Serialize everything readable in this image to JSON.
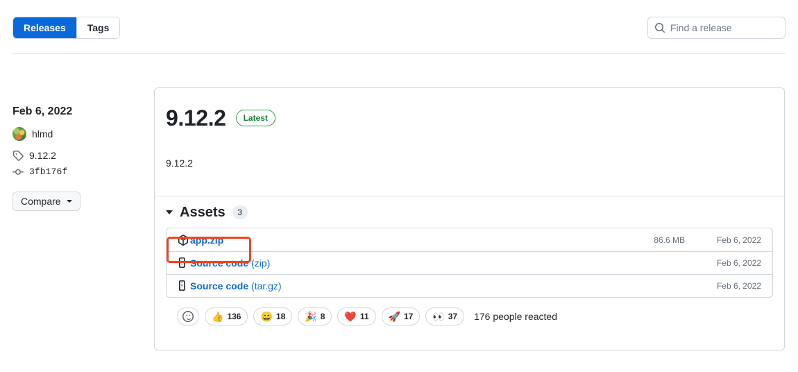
{
  "tabs": {
    "releases_label": "Releases",
    "tags_label": "Tags"
  },
  "search": {
    "placeholder": "Find a release",
    "value": "",
    "icon": "search-icon"
  },
  "sidebar": {
    "date": "Feb 6, 2022",
    "author": "hlmd",
    "tag": "9.12.2",
    "commit": "3fb176f",
    "compare_label": "Compare"
  },
  "release": {
    "version": "9.12.2",
    "badge": "Latest",
    "body": "9.12.2"
  },
  "assets": {
    "title": "Assets",
    "count": "3",
    "rows": [
      {
        "name": "app.zip",
        "ext": "",
        "size": "86.6 MB",
        "date": "Feb 6, 2022",
        "icon": "package-icon"
      },
      {
        "name": "Source code",
        "ext": "(zip)",
        "size": "",
        "date": "Feb 6, 2022",
        "icon": "file-zip-icon"
      },
      {
        "name": "Source code",
        "ext": "(tar.gz)",
        "size": "",
        "date": "Feb 6, 2022",
        "icon": "file-zip-icon"
      }
    ]
  },
  "reactions": {
    "add_icon": "smiley-icon",
    "items": [
      {
        "emoji": "👍",
        "count": "136",
        "name": "thumbsup"
      },
      {
        "emoji": "😄",
        "count": "18",
        "name": "laugh"
      },
      {
        "emoji": "🎉",
        "count": "8",
        "name": "hooray"
      },
      {
        "emoji": "❤️",
        "count": "11",
        "name": "heart"
      },
      {
        "emoji": "🚀",
        "count": "17",
        "name": "rocket"
      },
      {
        "emoji": "👀",
        "count": "37",
        "name": "eyes"
      }
    ],
    "summary": "176 people reacted"
  },
  "colors": {
    "accent": "#0969da",
    "success": "#1a7f37",
    "highlight": "#f6421b",
    "border": "#d0d7de"
  }
}
